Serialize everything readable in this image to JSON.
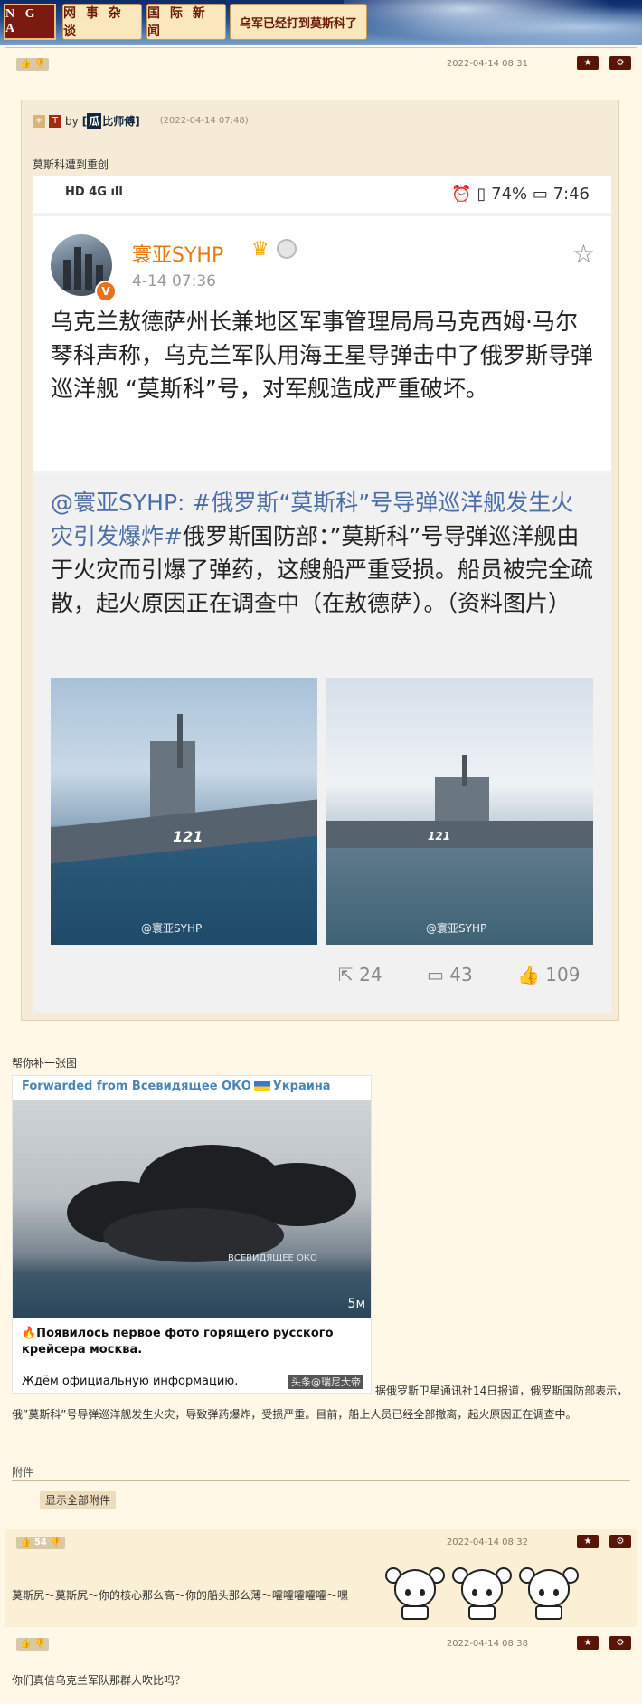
{
  "header": {
    "logo": "N G A",
    "breadcrumbs": [
      "网 事 杂 谈",
      "国 际 新 闻",
      "乌军已经打到莫斯科了"
    ]
  },
  "post1": {
    "time": "2022-04-14 08:31",
    "quote": {
      "plus": "+",
      "t": "T",
      "by": "by",
      "author_box": "瓜",
      "author": "比师傅]",
      "author_prefix": "[",
      "time": "(2022-04-14 07:48)",
      "title": "莫斯科遭到重创",
      "screenshot": {
        "status_left": "HD 4G ıll",
        "status_right_icons": "⏰ ▯ 74% ▭ 7:46",
        "weibo_name": "寰亚SYHP",
        "weibo_time": "4-14 07:36",
        "weibo_body": "乌克兰敖德萨州长兼地区军事管理局局马克西姆·马尔琴科声称，乌克兰军队用海王星导弹击中了俄罗斯导弹巡洋舰 “莫斯科”号，对军舰造成严重破坏。",
        "repost_user": "@寰亚SYHP",
        "repost_tag": ": #俄罗斯“莫斯科”号导弹巡洋舰发生火灾引发爆炸#",
        "repost_body": "俄罗斯国防部：”莫斯科”号导弹巡洋舰由于火灾而引爆了弹药，这艘船严重受损。船员被完全疏散，起火原因正在调查中（在敖德萨）。（资料图片）",
        "img_num": "121",
        "watermark": "@寰亚SYHP",
        "shares": "24",
        "comments": "43",
        "likes": "109"
      }
    },
    "caption": "帮你补一张图",
    "telegram": {
      "forwarded": "Forwarded from Всевидящее ОКО",
      "country": "Украина",
      "duration": "5м",
      "logo": "ВСЕВИДЯЩЕЕ ОКО",
      "text1": "🔥Появилось первое фото горящего русского крейсера москва.",
      "text2": "Ждём официальную информацию.",
      "wm": "头条@瑞尼大帝"
    },
    "after_text": "据俄罗斯卫星通讯社14日报道，俄罗斯国防部表示，俄”莫斯科”号导弹巡洋舰发生火灾，导致弹药爆炸，受损严重。目前，船上人员已经全部撤离，起火原因正在调查中。",
    "attachments_label": "附件",
    "show_all": "显示全部附件"
  },
  "post2": {
    "likes": "54",
    "time": "2022-04-14 08:32",
    "text": "莫斯尻～莫斯尻～你的核心那么高～你的船头那么薄～嚯嚯嚯嚯嚯～嘿"
  },
  "post3": {
    "time": "2022-04-14 08:38",
    "text": "你们真信乌克兰军队那群人吹比吗？"
  },
  "colors": {
    "brand": "#7b1a0f",
    "background": "#fff8e7",
    "weibo_orange": "#e8780c",
    "link_blue": "#4c6ea8"
  }
}
